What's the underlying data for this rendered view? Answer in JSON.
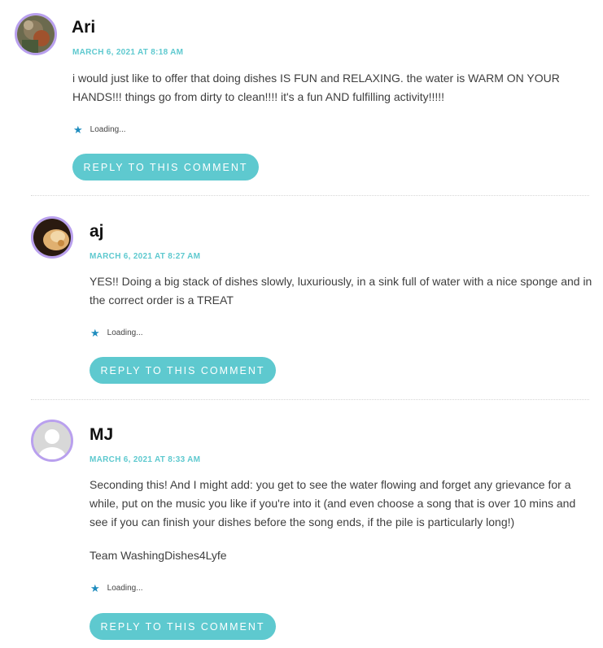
{
  "comments": [
    {
      "author": "Ari",
      "date": "MARCH 6, 2021 AT 8:18 AM",
      "paragraphs": [
        "i would just like to offer that doing dishes IS FUN and RELAXING. the water is WARM ON YOUR HANDS!!! things go from dirty to clean!!!! it's a fun AND fulfilling activity!!!!!"
      ],
      "like_status": "Loading...",
      "reply_label": "REPLY TO THIS COMMENT"
    },
    {
      "author": "aj",
      "date": "MARCH 6, 2021 AT 8:27 AM",
      "paragraphs": [
        "YES!! Doing a big stack of dishes slowly, luxuriously, in a sink full of water with a nice sponge and in the correct order is a TREAT"
      ],
      "like_status": "Loading...",
      "reply_label": "REPLY TO THIS COMMENT"
    },
    {
      "author": "MJ",
      "date": "MARCH 6, 2021 AT 8:33 AM",
      "paragraphs": [
        "Seconding this! And I might add: you get to see the water flowing and forget any grievance for a while, put on the music you like if you're into it (and even choose a song that is over 10 mins and see if you can finish your dishes before the song ends, if the pile is particularly long!)",
        "Team WashingDishes4Lyfe"
      ],
      "like_status": "Loading...",
      "reply_label": "REPLY TO THIS COMMENT"
    }
  ],
  "colors": {
    "accent": "#5ec9cf",
    "avatar_border": "#b9a0ee",
    "star": "#1e8cbe"
  }
}
